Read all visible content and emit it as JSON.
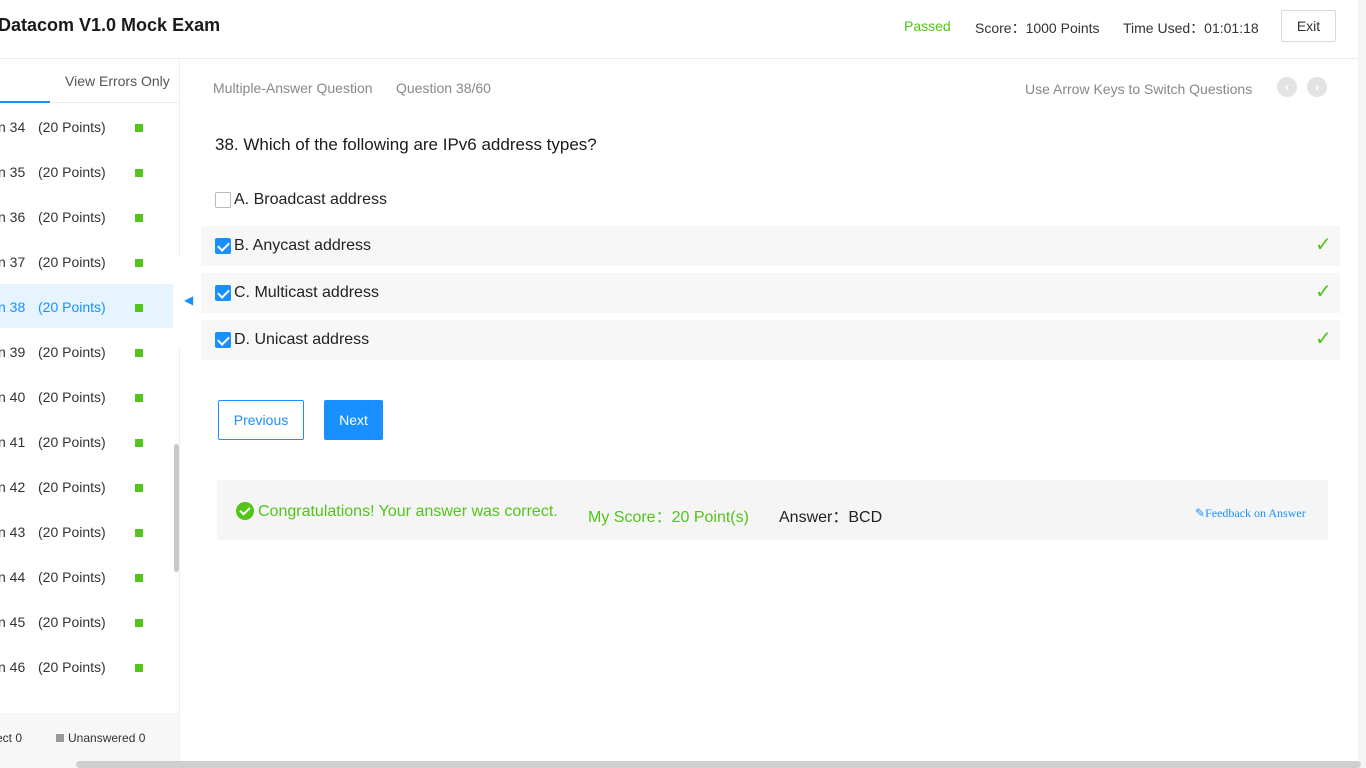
{
  "header": {
    "title": "Datacom V1.0 Mock Exam",
    "status": "Passed",
    "score": "Score：1000 Points",
    "time_used": "Time Used：01:01:18",
    "exit_label": "Exit"
  },
  "sidebar": {
    "tab_errors": "View Errors Only",
    "items": [
      {
        "num": "n 34",
        "points": "(20 Points)"
      },
      {
        "num": "n 35",
        "points": "(20 Points)"
      },
      {
        "num": "n 36",
        "points": "(20 Points)"
      },
      {
        "num": "n 37",
        "points": "(20 Points)"
      },
      {
        "num": "n 38",
        "points": "(20 Points)"
      },
      {
        "num": "n 39",
        "points": "(20 Points)"
      },
      {
        "num": "n 40",
        "points": "(20 Points)"
      },
      {
        "num": "n 41",
        "points": "(20 Points)"
      },
      {
        "num": "n 42",
        "points": "(20 Points)"
      },
      {
        "num": "n 43",
        "points": "(20 Points)"
      },
      {
        "num": "n 44",
        "points": "(20 Points)"
      },
      {
        "num": "n 45",
        "points": "(20 Points)"
      },
      {
        "num": "n 46",
        "points": "(20 Points)"
      }
    ],
    "footer": {
      "correct": "ect 0",
      "unanswered": "Unanswered 0"
    }
  },
  "question": {
    "type": "Multiple-Answer Question",
    "counter": "Question 38/60",
    "hint": "Use Arrow Keys to Switch Questions",
    "text": "38. Which of the following are IPv6 address types?",
    "options": [
      {
        "label": "A. Broadcast address",
        "checked": false
      },
      {
        "label": "B. Anycast address",
        "checked": true
      },
      {
        "label": "C. Multicast address",
        "checked": true
      },
      {
        "label": "D. Unicast address",
        "checked": true
      }
    ]
  },
  "buttons": {
    "previous": "Previous",
    "next": "Next"
  },
  "result": {
    "message": "Congratulations! Your answer was correct.",
    "my_score": "My Score：20 Point(s)",
    "answer": "Answer：BCD",
    "feedback": "Feedback on Answer"
  },
  "colors": {
    "accent": "#1890ff",
    "success": "#52c41a"
  }
}
